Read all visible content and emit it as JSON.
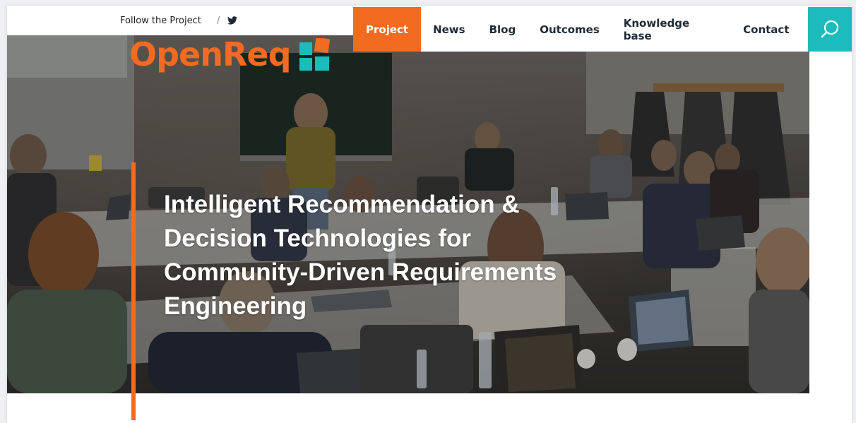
{
  "topbar": {
    "follow_label": "Follow the Project",
    "separator": "/"
  },
  "nav": {
    "items": [
      {
        "label": "Project",
        "active": true
      },
      {
        "label": "News"
      },
      {
        "label": "Blog"
      },
      {
        "label": "Outcomes"
      },
      {
        "label": "Knowledge base"
      },
      {
        "label": "Contact"
      }
    ],
    "search_icon": "search-icon"
  },
  "hero": {
    "logo_text": "OpenReq",
    "headline_lines": [
      "Intelligent Recommendation &",
      "Decision Technologies for",
      "Community-Driven Requirements",
      "Engineering"
    ]
  },
  "colors": {
    "accent_orange": "#f26b21",
    "accent_teal": "#1cbcbc",
    "nav_text": "#1e2a36"
  }
}
